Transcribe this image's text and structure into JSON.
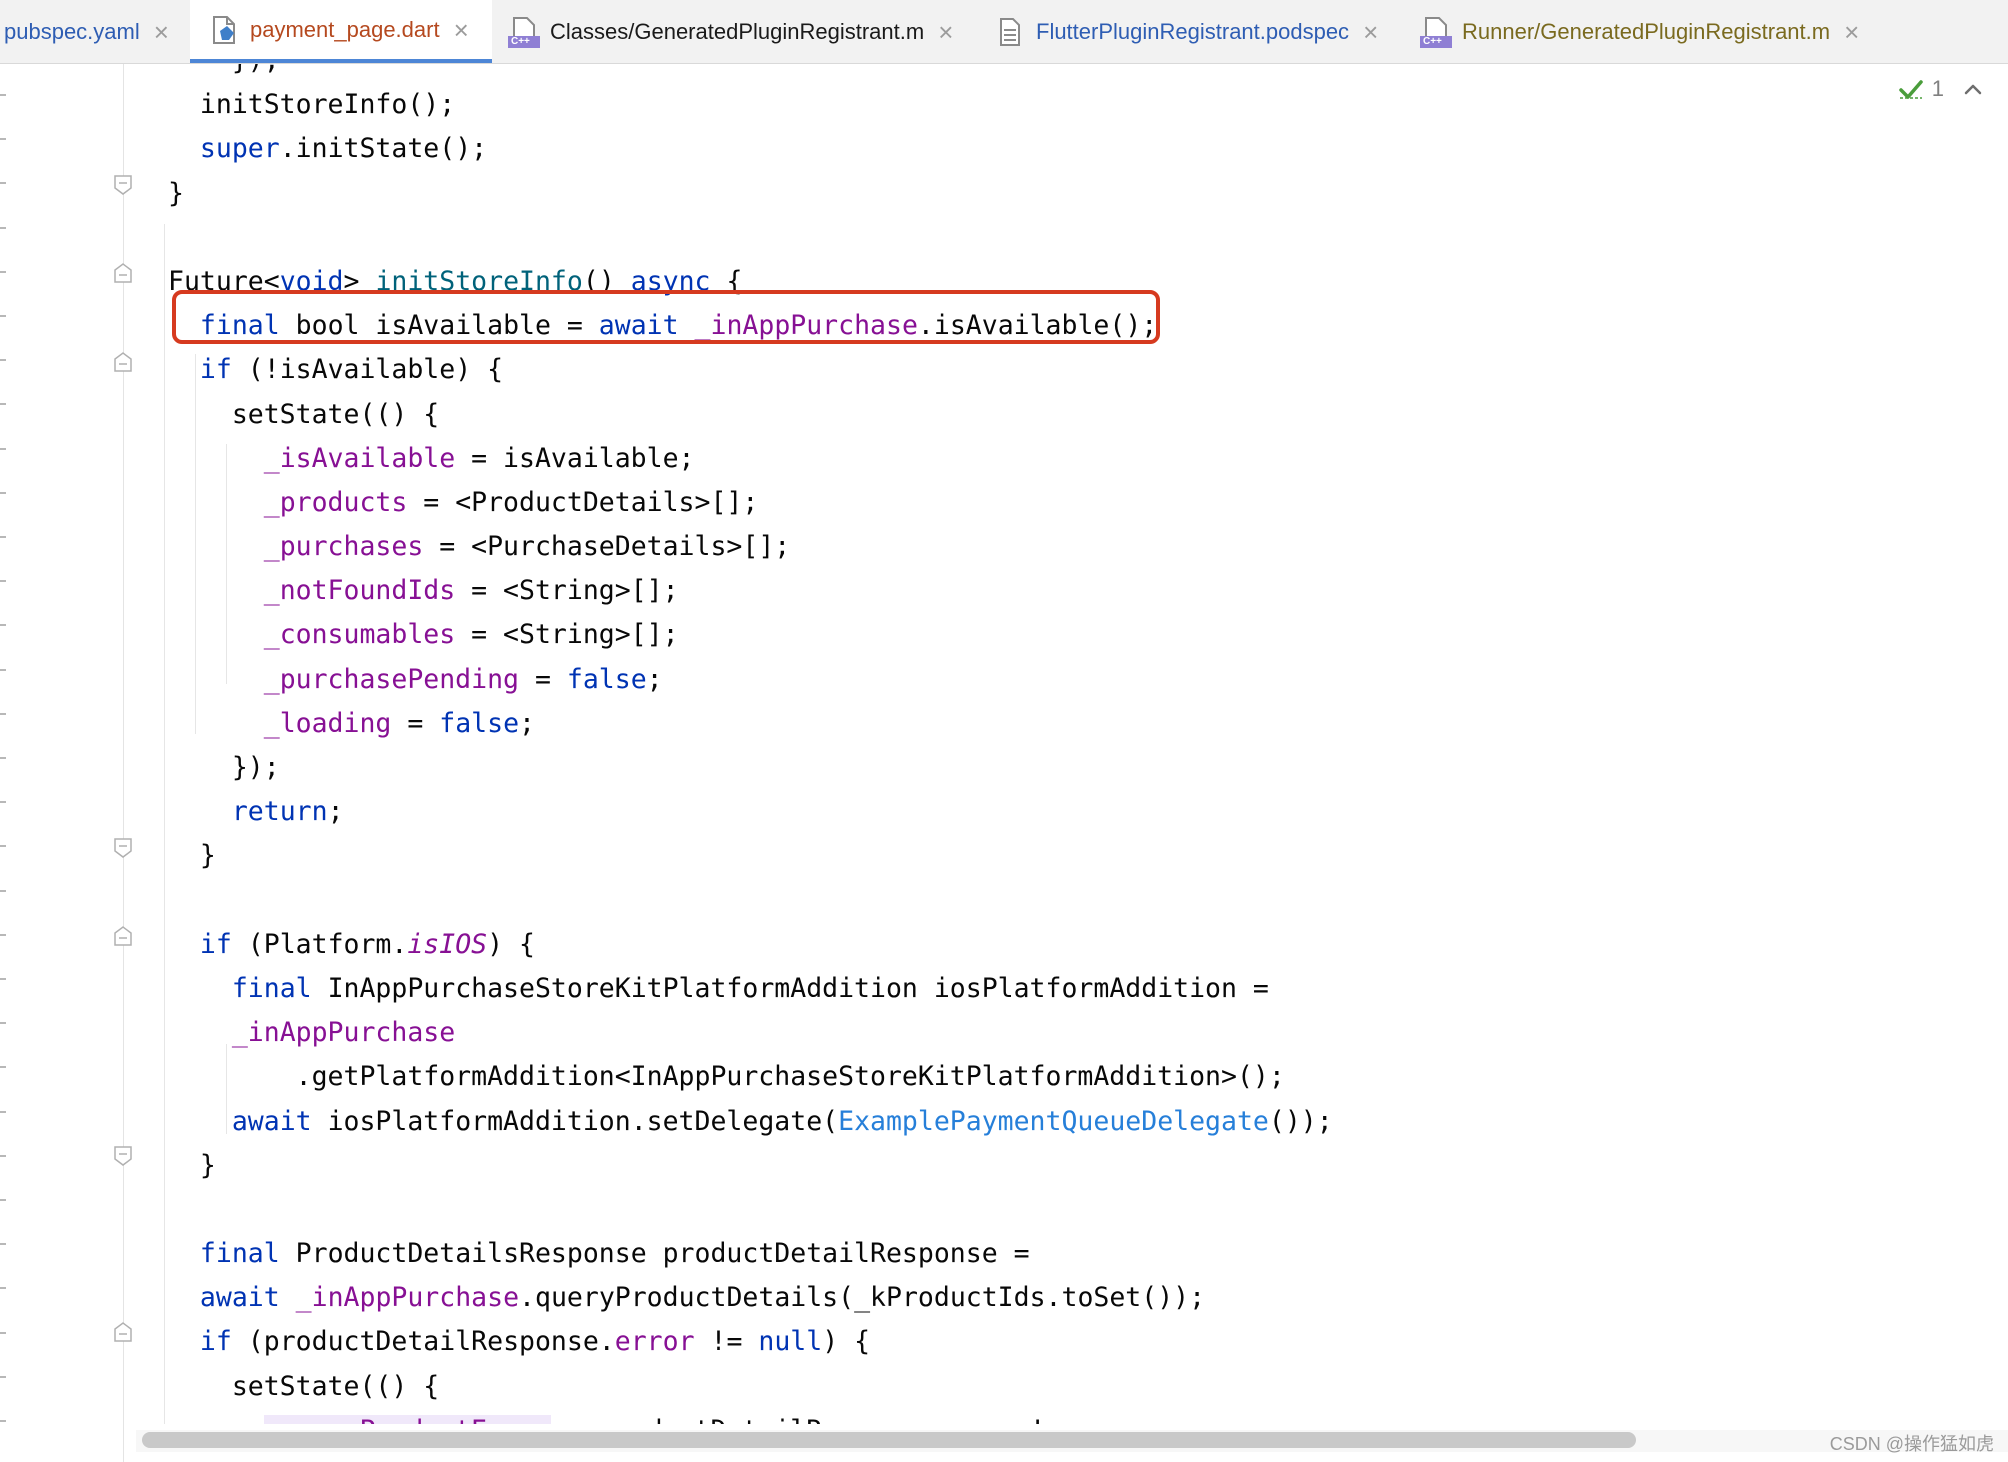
{
  "tabs": [
    {
      "label": "pubspec.yaml",
      "active": false,
      "color": "#2e5db3",
      "icon": "yaml-file-icon"
    },
    {
      "label": "payment_page.dart",
      "active": true,
      "color": "#b5491f",
      "icon": "dart-file-icon"
    },
    {
      "label": "Classes/GeneratedPluginRegistrant.m",
      "active": false,
      "color": "#1a1a1a",
      "icon": "cpp-file-icon"
    },
    {
      "label": "FlutterPluginRegistrant.podspec",
      "active": false,
      "color": "#2e5db3",
      "icon": "text-file-icon"
    },
    {
      "label": "Runner/GeneratedPluginRegistrant.m",
      "active": false,
      "color": "#7a6a1f",
      "icon": "cpp-file-icon"
    }
  ],
  "icon_badges": {
    "cpp": "C++"
  },
  "inspection": {
    "count": "1",
    "icon": "check-mark-icon",
    "arrow": "chevron-up-icon"
  },
  "watermark": "CSDN @操作猛如虎",
  "colors": {
    "keyword": "#0033b3",
    "field": "#871094",
    "function": "#00627a",
    "class_ref": "#267fd9",
    "highlight_box": "#d63a1f",
    "active_tab_underline": "#4d86d6"
  },
  "code_lines": [
    [
      [
        "    ",
        ""
      ],
      [
        "});",
        ""
      ]
    ],
    [
      [
        "  initStoreInfo();",
        ""
      ]
    ],
    [
      [
        "  ",
        ""
      ],
      [
        "super",
        "kw"
      ],
      [
        ".initState();",
        ""
      ]
    ],
    [
      [
        "}",
        ""
      ]
    ],
    [
      [
        "",
        ""
      ]
    ],
    [
      [
        "Future<",
        ""
      ],
      [
        "void",
        "kw"
      ],
      [
        "> ",
        ""
      ],
      [
        "initStoreInfo",
        "fn"
      ],
      [
        "() ",
        ""
      ],
      [
        "async",
        "kw"
      ],
      [
        " {",
        ""
      ]
    ],
    [
      [
        "  ",
        ""
      ],
      [
        "final",
        "kw"
      ],
      [
        " bool isAvailable = ",
        ""
      ],
      [
        "await",
        "kw"
      ],
      [
        " ",
        ""
      ],
      [
        "_inAppPurchase",
        "fld"
      ],
      [
        ".isAvailable();",
        ""
      ]
    ],
    [
      [
        "  ",
        ""
      ],
      [
        "if",
        "kw"
      ],
      [
        " (!isAvailable) {",
        ""
      ]
    ],
    [
      [
        "    setState(() {",
        ""
      ]
    ],
    [
      [
        "      ",
        ""
      ],
      [
        "_isAvailable",
        "fld"
      ],
      [
        " = isAvailable;",
        ""
      ]
    ],
    [
      [
        "      ",
        ""
      ],
      [
        "_products",
        "fld"
      ],
      [
        " = <ProductDetails>[];",
        ""
      ]
    ],
    [
      [
        "      ",
        ""
      ],
      [
        "_purchases",
        "fld"
      ],
      [
        " = <PurchaseDetails>[];",
        ""
      ]
    ],
    [
      [
        "      ",
        ""
      ],
      [
        "_notFoundIds",
        "fld"
      ],
      [
        " = <String>[];",
        ""
      ]
    ],
    [
      [
        "      ",
        ""
      ],
      [
        "_consumables",
        "fld"
      ],
      [
        " = <String>[];",
        ""
      ]
    ],
    [
      [
        "      ",
        ""
      ],
      [
        "_purchasePending",
        "fld"
      ],
      [
        " = ",
        ""
      ],
      [
        "false",
        "kw"
      ],
      [
        ";",
        ""
      ]
    ],
    [
      [
        "      ",
        ""
      ],
      [
        "_loading",
        "fld"
      ],
      [
        " = ",
        ""
      ],
      [
        "false",
        "kw"
      ],
      [
        ";",
        ""
      ]
    ],
    [
      [
        "    });",
        ""
      ]
    ],
    [
      [
        "    ",
        ""
      ],
      [
        "return",
        "kw"
      ],
      [
        ";",
        ""
      ]
    ],
    [
      [
        "  }",
        ""
      ]
    ],
    [
      [
        "",
        ""
      ]
    ],
    [
      [
        "  ",
        ""
      ],
      [
        "if",
        "kw"
      ],
      [
        " (Platform.",
        ""
      ],
      [
        "isIOS",
        "itl"
      ],
      [
        ") {",
        ""
      ]
    ],
    [
      [
        "    ",
        ""
      ],
      [
        "final",
        "kw"
      ],
      [
        " InAppPurchaseStoreKitPlatformAddition iosPlatformAddition =",
        ""
      ]
    ],
    [
      [
        "    ",
        ""
      ],
      [
        "_inAppPurchase",
        "fld"
      ]
    ],
    [
      [
        "        .getPlatformAddition<InAppPurchaseStoreKitPlatformAddition>();",
        ""
      ]
    ],
    [
      [
        "    ",
        ""
      ],
      [
        "await",
        "kw"
      ],
      [
        " iosPlatformAddition.setDelegate(",
        ""
      ],
      [
        "ExamplePaymentQueueDelegate",
        "cls"
      ],
      [
        "());",
        ""
      ]
    ],
    [
      [
        "  }",
        ""
      ]
    ],
    [
      [
        "",
        ""
      ]
    ],
    [
      [
        "  ",
        ""
      ],
      [
        "final",
        "kw"
      ],
      [
        " ProductDetailsResponse productDetailResponse =",
        ""
      ]
    ],
    [
      [
        "  ",
        ""
      ],
      [
        "await",
        "kw"
      ],
      [
        " ",
        ""
      ],
      [
        "_inAppPurchase",
        "fld"
      ],
      [
        ".queryProductDetails(_kProductIds.toSet());",
        ""
      ]
    ],
    [
      [
        "  ",
        ""
      ],
      [
        "if",
        "kw"
      ],
      [
        " (productDetailResponse.",
        ""
      ],
      [
        "error",
        "fld"
      ],
      [
        " != ",
        ""
      ],
      [
        "null",
        "kw"
      ],
      [
        ") {",
        ""
      ]
    ],
    [
      [
        "    setState(() {",
        ""
      ]
    ],
    [
      [
        "      ",
        ""
      ],
      [
        "_queryProductError",
        "fld hl-bg"
      ],
      [
        " = productDetailResponse.",
        ""
      ],
      [
        "error",
        "fld"
      ],
      [
        "!.",
        ""
      ],
      [
        "message",
        "fld"
      ],
      [
        ";",
        ""
      ]
    ]
  ]
}
